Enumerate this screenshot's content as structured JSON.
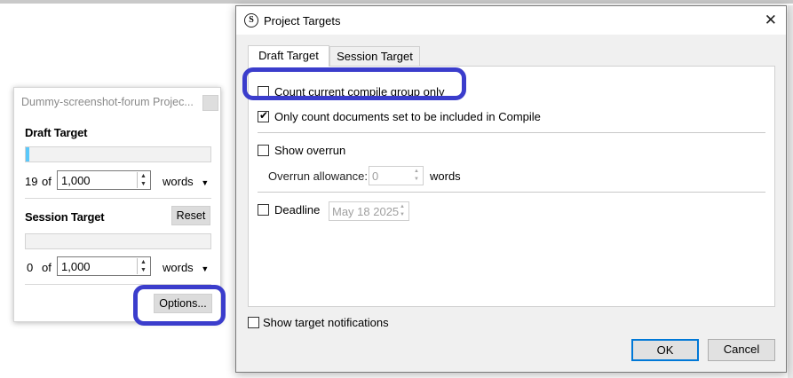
{
  "panel": {
    "title": "Dummy-screenshot-forum Projec...",
    "draft": {
      "heading": "Draft Target",
      "progress": 0.019,
      "count": "19",
      "of": "of",
      "target": "1,000",
      "unit": "words"
    },
    "session": {
      "heading": "Session Target",
      "reset_label": "Reset",
      "progress": 0,
      "count": "0",
      "of": "of",
      "target": "1,000",
      "unit": "words"
    },
    "options_label": "Options..."
  },
  "dialog": {
    "title": "Project Targets",
    "tabs": [
      {
        "label": "Draft Target",
        "active": true
      },
      {
        "label": "Session Target",
        "active": false
      }
    ],
    "options": {
      "count_compile_group": {
        "label": "Count current compile group only",
        "checked": false
      },
      "only_count_included": {
        "label": "Only count documents set to be included in Compile",
        "checked": true
      },
      "show_overrun": {
        "label": "Show overrun",
        "checked": false
      },
      "overrun_label": "Overrun allowance:",
      "overrun_value": "0",
      "overrun_unit": "words",
      "deadline": {
        "label": "Deadline",
        "checked": false
      },
      "deadline_value": "May 18 2025"
    },
    "show_notifications": {
      "label": "Show target notifications",
      "checked": false
    },
    "ok_label": "OK",
    "cancel_label": "Cancel"
  },
  "colors": {
    "highlight": "#3b3dcc",
    "progress_fill": "#5ac8fa",
    "default_button_border": "#0078d7"
  }
}
